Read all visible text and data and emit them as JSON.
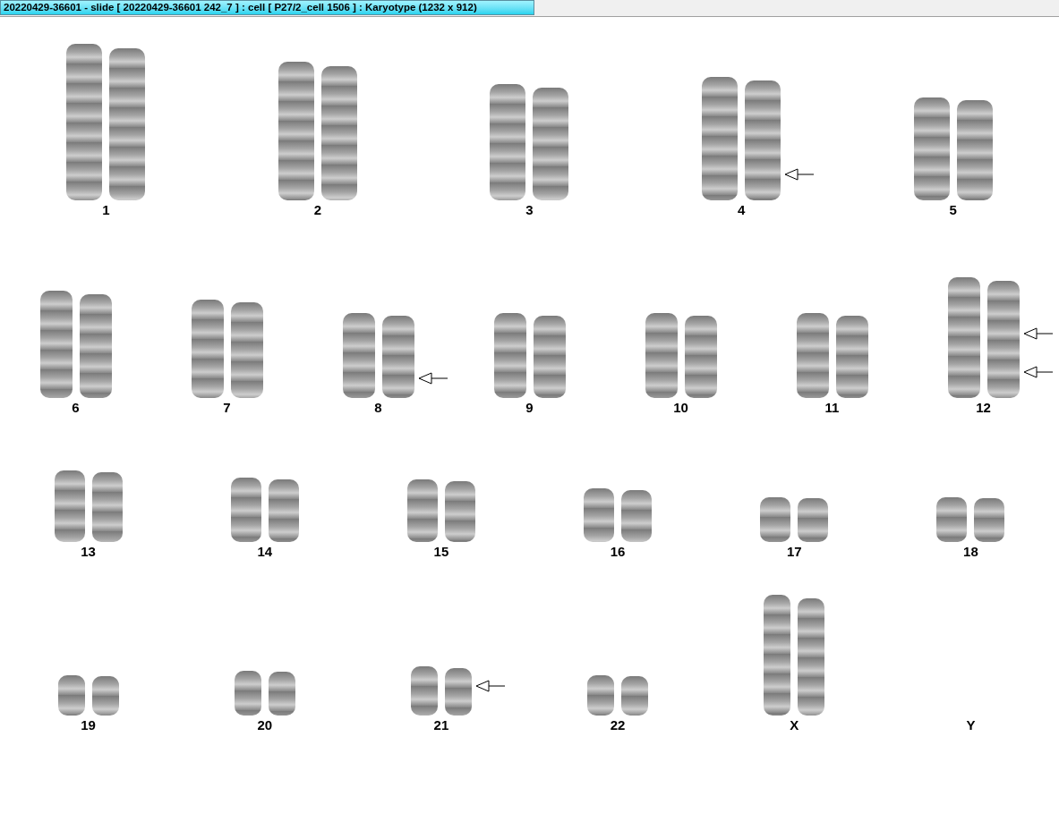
{
  "window": {
    "title": "20220429-36601 - slide [ 20220429-36601 242_7 ] : cell [ P27/2_cell 1506 ] : Karyotype  (1232 x 912)"
  },
  "rows": [
    {
      "items": [
        {
          "label": "1",
          "kind": "pair",
          "arrow_middle": false,
          "arrow_lower": false
        },
        {
          "label": "2",
          "kind": "pair",
          "arrow_middle": false,
          "arrow_lower": false
        },
        {
          "label": "3",
          "kind": "pair",
          "arrow_middle": false,
          "arrow_lower": false
        },
        {
          "label": "4",
          "kind": "pair",
          "arrow_middle": false,
          "arrow_lower": true
        },
        {
          "label": "5",
          "kind": "pair",
          "arrow_middle": false,
          "arrow_lower": false
        }
      ]
    },
    {
      "items": [
        {
          "label": "6",
          "kind": "pair",
          "arrow_middle": false,
          "arrow_lower": false
        },
        {
          "label": "7",
          "kind": "pair",
          "arrow_middle": false,
          "arrow_lower": false
        },
        {
          "label": "8",
          "kind": "pair",
          "arrow_middle": false,
          "arrow_lower": true
        },
        {
          "label": "9",
          "kind": "pair",
          "arrow_middle": false,
          "arrow_lower": false
        },
        {
          "label": "10",
          "kind": "pair",
          "arrow_middle": false,
          "arrow_lower": false
        },
        {
          "label": "11",
          "kind": "pair",
          "arrow_middle": false,
          "arrow_lower": false
        },
        {
          "label": "12",
          "kind": "pair",
          "arrow_middle": true,
          "arrow_lower": true
        }
      ]
    },
    {
      "items": [
        {
          "label": "13",
          "kind": "pair",
          "arrow_middle": false,
          "arrow_lower": false
        },
        {
          "label": "14",
          "kind": "pair",
          "arrow_middle": false,
          "arrow_lower": false
        },
        {
          "label": "15",
          "kind": "pair",
          "arrow_middle": false,
          "arrow_lower": false
        },
        {
          "label": "16",
          "kind": "pair",
          "arrow_middle": false,
          "arrow_lower": false
        },
        {
          "label": "17",
          "kind": "pair",
          "arrow_middle": false,
          "arrow_lower": false
        },
        {
          "label": "18",
          "kind": "pair",
          "arrow_middle": false,
          "arrow_lower": false
        }
      ]
    },
    {
      "items": [
        {
          "label": "19",
          "kind": "pair",
          "arrow_middle": false,
          "arrow_lower": false
        },
        {
          "label": "20",
          "kind": "pair",
          "arrow_middle": false,
          "arrow_lower": false
        },
        {
          "label": "21",
          "kind": "pair",
          "arrow_middle": true,
          "arrow_lower": false
        },
        {
          "label": "22",
          "kind": "pair",
          "arrow_middle": false,
          "arrow_lower": false
        },
        {
          "label": "X",
          "kind": "pair",
          "arrow_middle": false,
          "arrow_lower": false
        },
        {
          "label": "Y",
          "kind": "empty"
        }
      ]
    }
  ]
}
